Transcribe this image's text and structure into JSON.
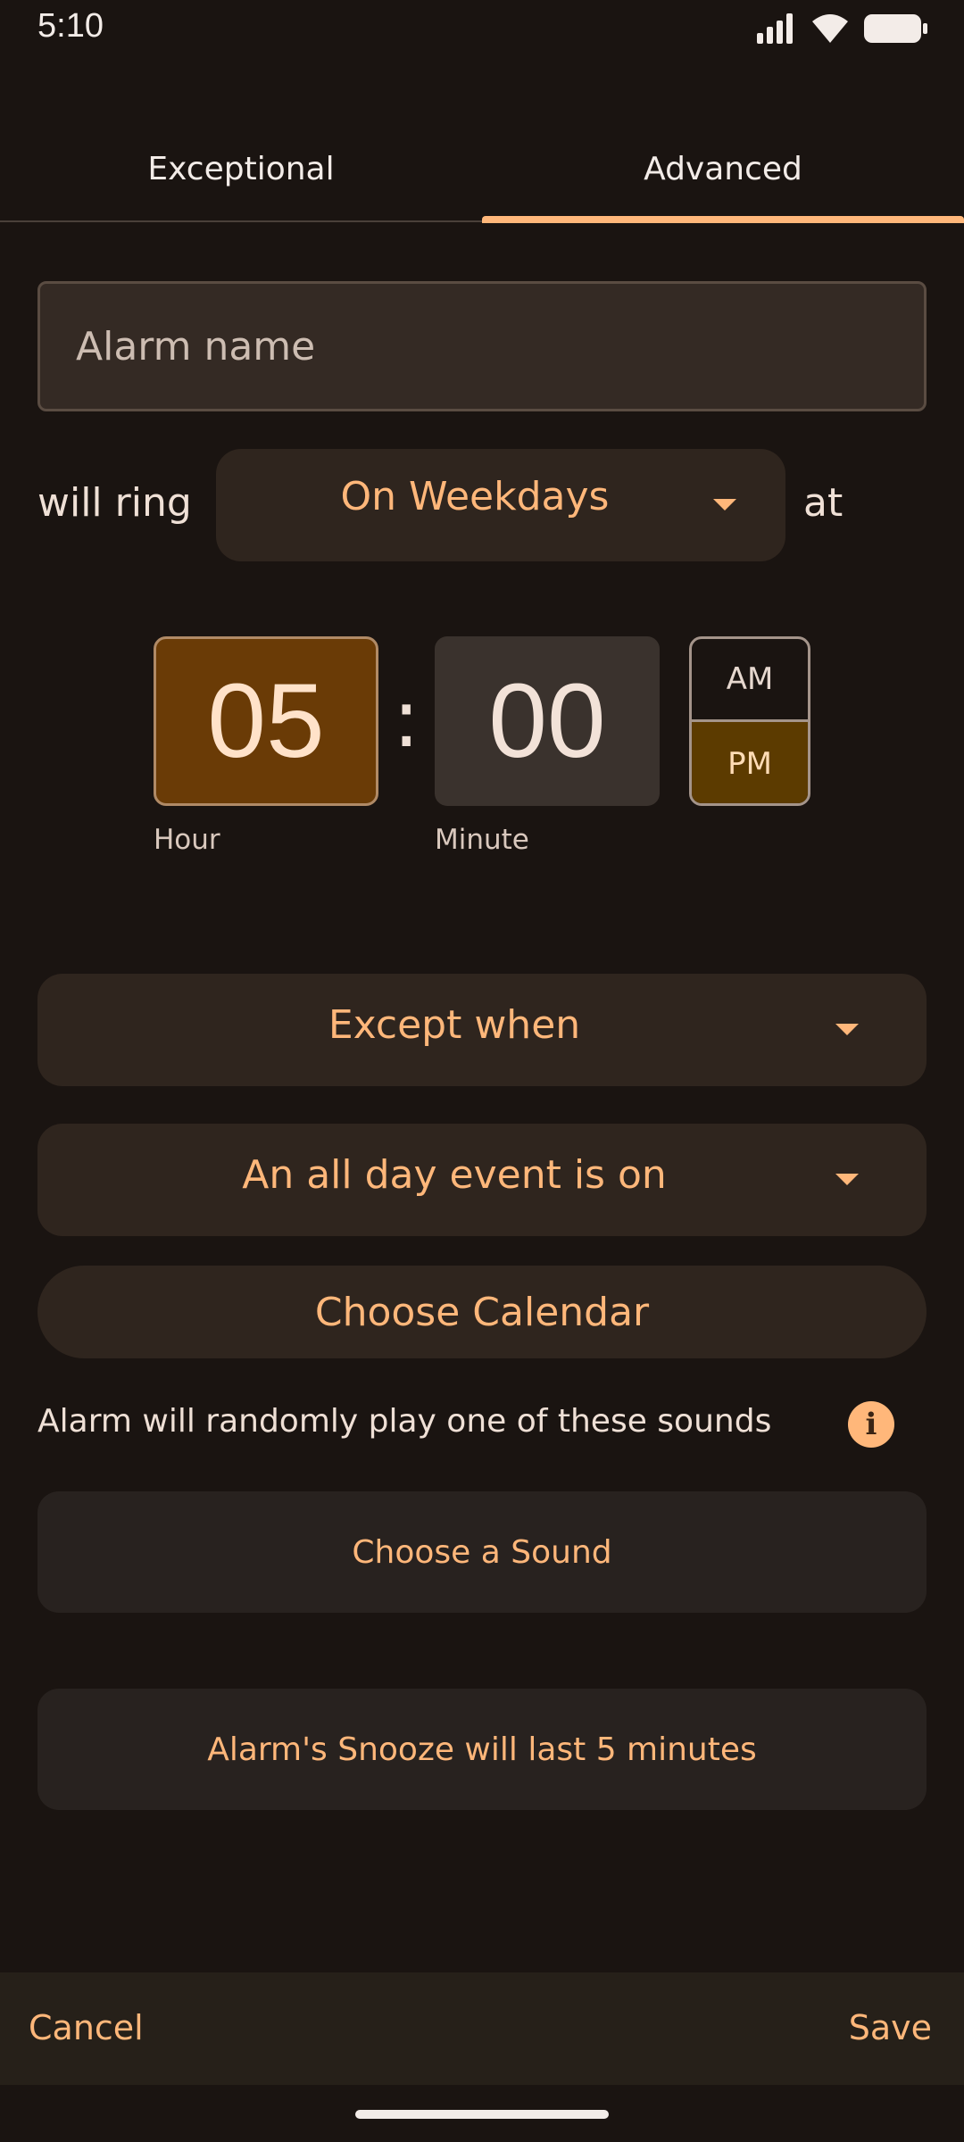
{
  "status_bar": {
    "time": "5:10",
    "icons": [
      "signal-icon",
      "wifi-icon",
      "battery-icon"
    ]
  },
  "tabs": [
    {
      "label": "Exceptional",
      "selected": false
    },
    {
      "label": "Advanced",
      "selected": true
    }
  ],
  "form": {
    "name_placeholder": "Alarm name",
    "ring_prefix": "will ring",
    "repeat_value": "On Weekdays",
    "ring_suffix": "at"
  },
  "time": {
    "hour": "05",
    "separator": ":",
    "minute": "00",
    "am": "AM",
    "pm": "PM",
    "selected_period": "PM",
    "hour_label": "Hour",
    "minute_label": "Minute"
  },
  "conditions": {
    "except_label": "Except when",
    "event_label": "An all day event is on",
    "calendar_button": "Choose Calendar"
  },
  "sounds": {
    "description": "Alarm will randomly play one of these sounds",
    "info_icon": "i",
    "choose_button": "Choose a Sound"
  },
  "snooze": {
    "label": "Alarm's Snooze will last 5 minutes"
  },
  "actions": {
    "cancel": "Cancel",
    "save": "Save"
  },
  "colors": {
    "background": "#1a1411",
    "accent": "#ffb77a",
    "hour_selected": "#6a3b06",
    "pm_selected": "#5c3b00"
  }
}
